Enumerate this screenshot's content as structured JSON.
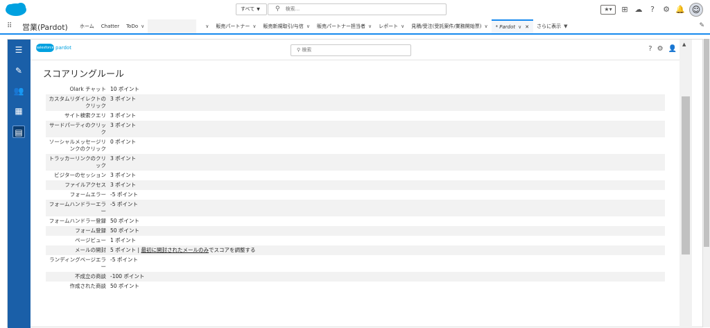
{
  "topbar": {
    "search_scope": "すべて",
    "search_placeholder": "検索..."
  },
  "nav": {
    "app_name": "営業(Pardot)",
    "items": [
      {
        "label": "ホーム",
        "chevron": false
      },
      {
        "label": "Chatter",
        "chevron": false
      },
      {
        "label": "ToDo",
        "chevron": true
      },
      {
        "label": "販売パートナー",
        "chevron": true
      },
      {
        "label": "販売新規取引/与信",
        "chevron": true
      },
      {
        "label": "販売パートナー担当者",
        "chevron": true
      },
      {
        "label": "レポート",
        "chevron": true
      },
      {
        "label": "見積/受注(受託案件/業務開始票)",
        "chevron": true
      }
    ],
    "active_tab": "* Pardot",
    "more_label": "さらに表示"
  },
  "pardot": {
    "logo_text": "pardot",
    "logo_cloud": "salesforce",
    "search_placeholder": "検索"
  },
  "page": {
    "title": "スコアリングルール",
    "rules": [
      {
        "label": "Olark チャット",
        "value": "10 ポイント"
      },
      {
        "label": "カスタムリダイレクトのクリック",
        "value": "3 ポイント"
      },
      {
        "label": "サイト検索クエリ",
        "value": "3 ポイント"
      },
      {
        "label": "サードパーティのクリック",
        "value": "3 ポイント"
      },
      {
        "label": "ソーシャルメッセージリンクのクリック",
        "value": "0 ポイント"
      },
      {
        "label": "トラッカーリンクのクリック",
        "value": "3 ポイント"
      },
      {
        "label": "ビジターのセッション",
        "value": "3 ポイント"
      },
      {
        "label": "ファイルアクセス",
        "value": "3 ポイント"
      },
      {
        "label": "フォームエラー",
        "value": "-5 ポイント"
      },
      {
        "label": "フォームハンドラーエラー",
        "value": "-5 ポイント"
      },
      {
        "label": "フォームハンドラー登録",
        "value": "50 ポイント"
      },
      {
        "label": "フォーム登録",
        "value": "50 ポイント"
      },
      {
        "label": "ページビュー",
        "value": "1 ポイント"
      },
      {
        "label": "メールの開封",
        "value": "5 ポイント |",
        "link": "最初に開封されたメールのみ",
        "suffix": "でスコアを調整する"
      },
      {
        "label": "ランディングページエラー",
        "value": "-5 ポイント"
      },
      {
        "label": "不成立の商談",
        "value": "-100 ポイント"
      },
      {
        "label": "作成された商談",
        "value": "50 ポイント"
      }
    ]
  }
}
